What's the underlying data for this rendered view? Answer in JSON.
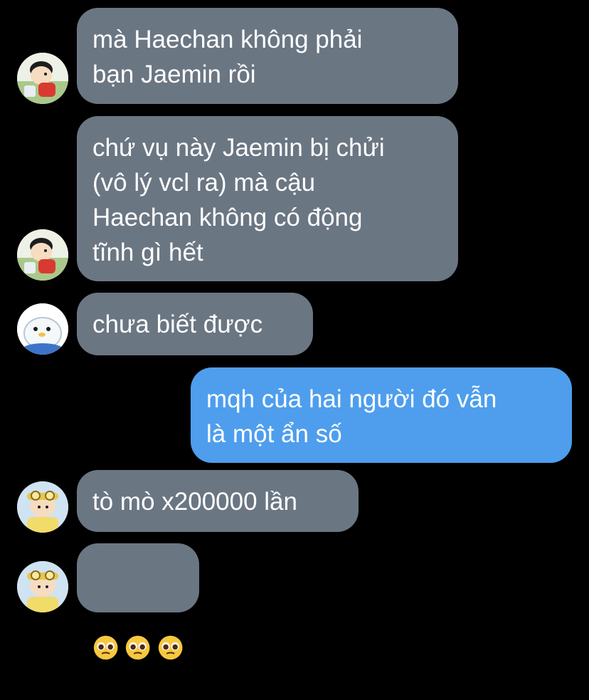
{
  "colors": {
    "background": "#000000",
    "incoming_bubble": "#6b7683",
    "outgoing_bubble": "#4e9eed",
    "text": "#ffffff"
  },
  "messages": [
    {
      "direction": "incoming",
      "avatar": "avatar-boy-red-shirt",
      "text": "mà Haechan không phải\nbạn Jaemin rồi"
    },
    {
      "direction": "incoming",
      "avatar": "avatar-boy-red-shirt",
      "text": "chứ vụ này Jaemin bị chửi\n(vô lý vcl ra) mà cậu\nHaechan không có động\ntĩnh gì hết"
    },
    {
      "direction": "incoming",
      "avatar": "avatar-white-penguin",
      "text": "chưa biết được"
    },
    {
      "direction": "outgoing",
      "avatar": "",
      "text": "mqh của hai người đó vẫn\nlà một ẩn số"
    },
    {
      "direction": "incoming",
      "avatar": "avatar-boy-goggles",
      "text": "tò mò x200000 lần"
    },
    {
      "direction": "incoming",
      "avatar": "avatar-boy-goggles",
      "text": "",
      "emojis": [
        "pleading-face-emoji",
        "pleading-face-emoji",
        "pleading-face-emoji"
      ]
    }
  ]
}
